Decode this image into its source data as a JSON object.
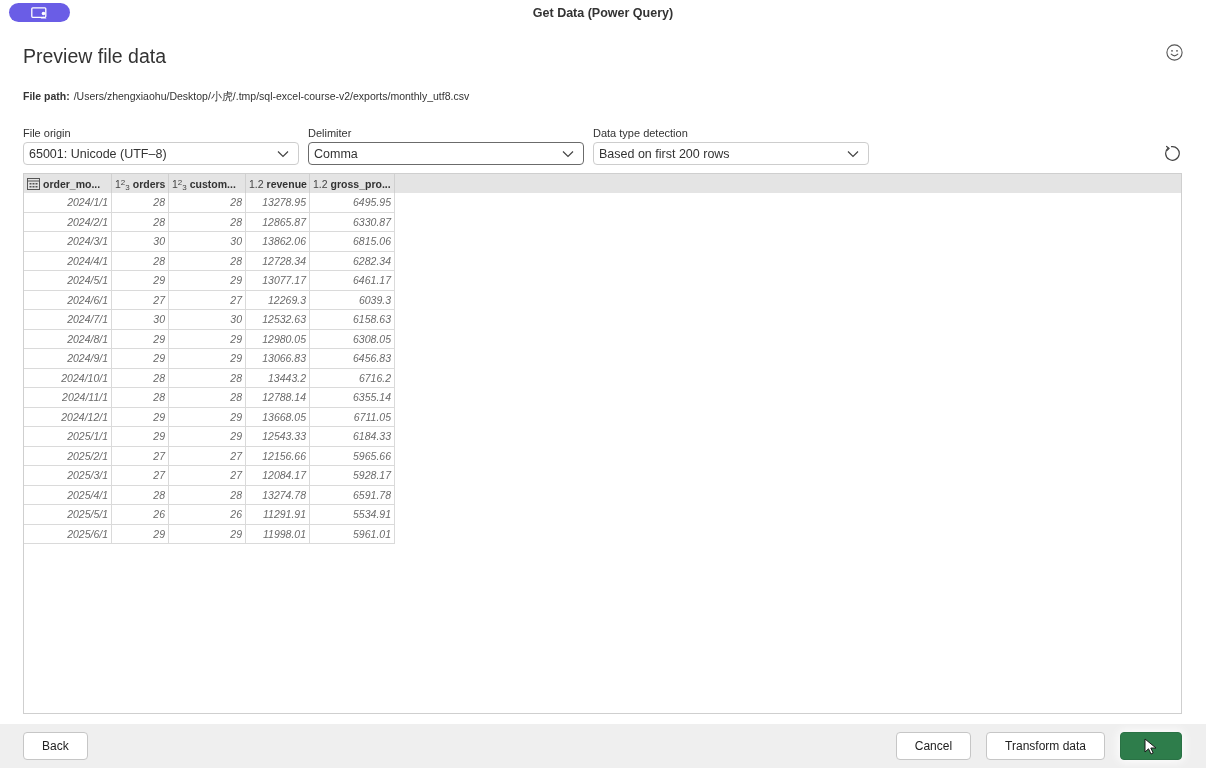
{
  "window": {
    "title": "Get Data (Power Query)"
  },
  "page": {
    "heading": "Preview file data",
    "file_path_label": "File path:",
    "file_path": "/Users/zhengxiaohu/Desktop/小虎/.tmp/sql-excel-course-v2/exports/monthly_utf8.csv"
  },
  "options": [
    {
      "label": "File origin",
      "value": "65001: Unicode (UTF–8)",
      "focused": false
    },
    {
      "label": "Delimiter",
      "value": "Comma",
      "focused": true
    },
    {
      "label": "Data type detection",
      "value": "Based on first 200 rows",
      "focused": false
    }
  ],
  "table": {
    "columns": [
      {
        "name": "order_mo...",
        "kind": "date"
      },
      {
        "name": "orders",
        "kind": "number",
        "type_label": "1$^{2}$$_{3}$"
      },
      {
        "name": "custom...",
        "kind": "number",
        "type_label": "1$^{2}$$_{3}$"
      },
      {
        "name": "revenue",
        "kind": "number",
        "type_label": "1.2"
      },
      {
        "name": "gross_pro...",
        "kind": "number",
        "type_label": "1.2"
      }
    ],
    "rows": [
      [
        "2024/1/1",
        "28",
        "28",
        "13278.95",
        "6495.95"
      ],
      [
        "2024/2/1",
        "28",
        "28",
        "12865.87",
        "6330.87"
      ],
      [
        "2024/3/1",
        "30",
        "30",
        "13862.06",
        "6815.06"
      ],
      [
        "2024/4/1",
        "28",
        "28",
        "12728.34",
        "6282.34"
      ],
      [
        "2024/5/1",
        "29",
        "29",
        "13077.17",
        "6461.17"
      ],
      [
        "2024/6/1",
        "27",
        "27",
        "12269.3",
        "6039.3"
      ],
      [
        "2024/7/1",
        "30",
        "30",
        "12532.63",
        "6158.63"
      ],
      [
        "2024/8/1",
        "29",
        "29",
        "12980.05",
        "6308.05"
      ],
      [
        "2024/9/1",
        "29",
        "29",
        "13066.83",
        "6456.83"
      ],
      [
        "2024/10/1",
        "28",
        "28",
        "13443.2",
        "6716.2"
      ],
      [
        "2024/11/1",
        "28",
        "28",
        "12788.14",
        "6355.14"
      ],
      [
        "2024/12/1",
        "29",
        "29",
        "13668.05",
        "6711.05"
      ],
      [
        "2025/1/1",
        "29",
        "29",
        "12543.33",
        "6184.33"
      ],
      [
        "2025/2/1",
        "27",
        "27",
        "12156.66",
        "5965.66"
      ],
      [
        "2025/3/1",
        "27",
        "27",
        "12084.17",
        "5928.17"
      ],
      [
        "2025/4/1",
        "28",
        "28",
        "13274.78",
        "6591.78"
      ],
      [
        "2025/5/1",
        "26",
        "26",
        "11291.91",
        "5534.91"
      ],
      [
        "2025/6/1",
        "29",
        "29",
        "11998.01",
        "5961.01"
      ]
    ]
  },
  "footer": {
    "left_buttons": [
      {
        "label": "Back",
        "kind": "secondary"
      }
    ],
    "right_buttons": [
      {
        "label": "Cancel",
        "kind": "secondary"
      },
      {
        "label": "Transform data",
        "kind": "secondary"
      },
      {
        "kind": "primary",
        "cursor_over": true
      }
    ]
  }
}
